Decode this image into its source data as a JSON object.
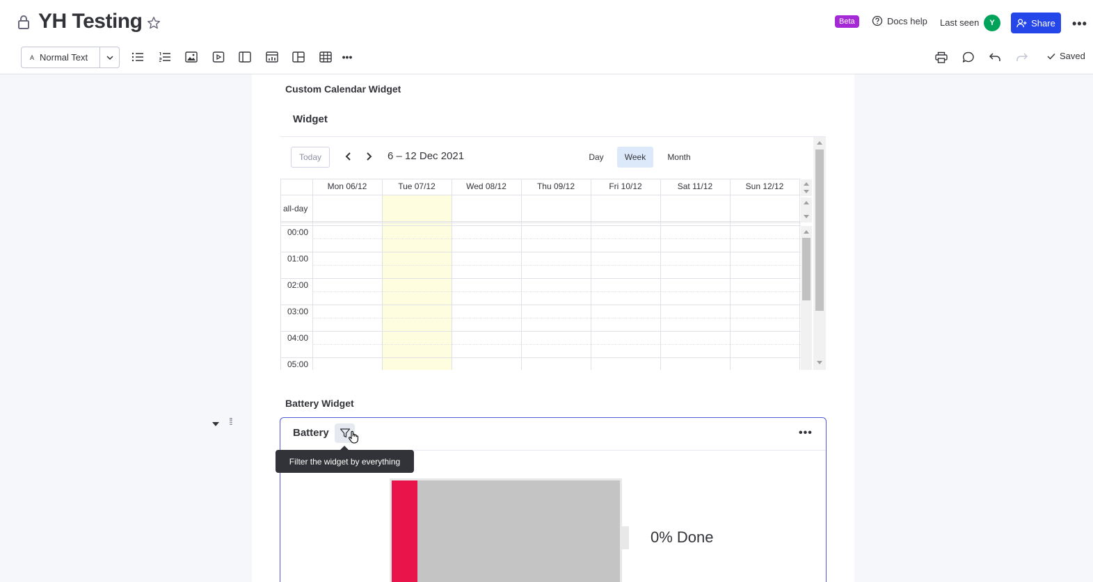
{
  "header": {
    "title": "YH Testing",
    "beta": "Beta",
    "docs_help": "Docs help",
    "last_seen": "Last seen",
    "avatar_initial": "Y",
    "share": "Share",
    "text_style": "Normal Text",
    "saved": "Saved"
  },
  "calendar_section": {
    "title": "Custom Calendar Widget",
    "widget_title": "Widget",
    "today": "Today",
    "range": "6 – 12 Dec 2021",
    "views": [
      "Day",
      "Week",
      "Month"
    ],
    "active_view": "Week",
    "days": [
      "Mon 06/12",
      "Tue 07/12",
      "Wed 08/12",
      "Thu 09/12",
      "Fri 10/12",
      "Sat 11/12",
      "Sun 12/12"
    ],
    "allday_label": "all-day",
    "times": [
      "00:00",
      "01:00",
      "02:00",
      "03:00",
      "04:00",
      "05:00"
    ],
    "today_color": "#fefde0"
  },
  "battery_section": {
    "title": "Battery Widget",
    "widget_title": "Battery",
    "tooltip": "Filter the widget by everything",
    "done_label": "0% Done",
    "progress_percent": 0,
    "fill_color": "#e8144a",
    "empty_color": "#c4c4c4"
  },
  "colors": {
    "accent": "#2546e8",
    "beta": "#a52ad6",
    "avatar": "#00a359"
  }
}
